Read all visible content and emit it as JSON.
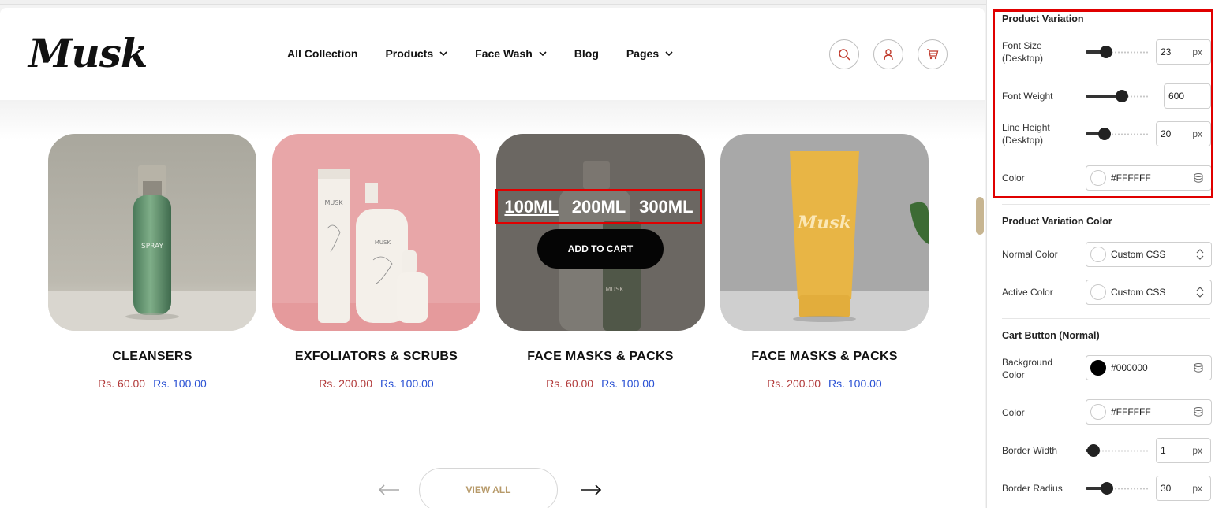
{
  "site": {
    "logo": "Musk",
    "nav": [
      {
        "label": "All Collection",
        "dropdown": false
      },
      {
        "label": "Products",
        "dropdown": true
      },
      {
        "label": "Face Wash",
        "dropdown": true
      },
      {
        "label": "Blog",
        "dropdown": false
      },
      {
        "label": "Pages",
        "dropdown": true
      }
    ],
    "header_icons": [
      "search-icon",
      "user-icon",
      "cart-icon"
    ],
    "products": [
      {
        "title": "CLEANSERS",
        "old_price": "Rs. 60.00",
        "new_price": "Rs. 100.00",
        "image": "green-spray-bottle",
        "bottle_label": "SPRAY\nMUSK"
      },
      {
        "title": "EXFOLIATORS & SCRUBS",
        "old_price": "Rs. 200.00",
        "new_price": "Rs. 100.00",
        "image": "white-bottles-pink",
        "bottle_label": "MUSK"
      },
      {
        "title": "FACE MASKS & PACKS",
        "old_price": "Rs. 60.00",
        "new_price": "Rs. 100.00",
        "image": "bottles-dark-overlay",
        "bottle_label": "MUSK"
      },
      {
        "title": "FACE MASKS & PACKS",
        "old_price": "Rs. 200.00",
        "new_price": "Rs. 100.00",
        "image": "yellow-tube",
        "bottle_label": "Musk"
      }
    ],
    "hover_variations": [
      "100ML",
      "200ML",
      "300ML"
    ],
    "add_to_cart": "ADD TO CART",
    "view_all": "VIEW ALL"
  },
  "panel": {
    "product_variation": {
      "title": "Product Variation",
      "font_size_label": "Font Size (Desktop)",
      "font_size": "23",
      "font_size_unit": "px",
      "font_size_level": 0.28,
      "font_weight_label": "Font Weight",
      "font_weight": "600",
      "font_weight_level": 0.6,
      "line_height_label": "Line Height (Desktop)",
      "line_height": "20",
      "line_height_unit": "px",
      "line_height_level": 0.25,
      "color_label": "Color",
      "color": "#FFFFFF"
    },
    "product_variation_color": {
      "title": "Product Variation Color",
      "normal_label": "Normal Color",
      "normal_value": "Custom CSS",
      "active_label": "Active Color",
      "active_value": "Custom CSS"
    },
    "cart_button": {
      "title": "Cart Button (Normal)",
      "bg_label": "Background Color",
      "bg_value": "#000000",
      "color_label": "Color",
      "color_value": "#FFFFFF",
      "border_width_label": "Border Width",
      "border_width": "1",
      "border_width_unit": "px",
      "border_width_level": 0.03,
      "border_radius_label": "Border Radius",
      "border_radius": "30",
      "border_radius_unit": "px",
      "border_radius_level": 0.3
    }
  },
  "colors": {
    "highlight": "#e00000",
    "old_price": "#b23b3b",
    "new_price": "#2b52d4",
    "view_all_text": "#b79a6a"
  }
}
